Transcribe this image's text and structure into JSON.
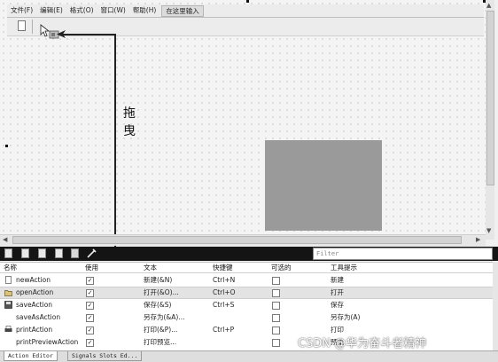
{
  "menubar": {
    "items": [
      "文件(F)",
      "编辑(E)",
      "格式(O)",
      "窗口(W)",
      "帮助(H)"
    ],
    "type_here": "在这里输入"
  },
  "annotation": {
    "drag_label": "拖\n曳"
  },
  "action_editor": {
    "filter_placeholder": "Filter",
    "columns": [
      "名称",
      "使用",
      "文本",
      "快捷键",
      "可选的",
      "工具提示"
    ],
    "rows": [
      {
        "name": "newAction",
        "used": true,
        "text": "新建(&N)",
        "shortcut": "Ctrl+N",
        "checkable": false,
        "tooltip": "新建",
        "icon": "new-file-icon",
        "selected": false
      },
      {
        "name": "openAction",
        "used": true,
        "text": "打开(&O)...",
        "shortcut": "Ctrl+O",
        "checkable": false,
        "tooltip": "打开",
        "icon": "open-folder-icon",
        "selected": true
      },
      {
        "name": "saveAction",
        "used": true,
        "text": "保存(&S)",
        "shortcut": "Ctrl+S",
        "checkable": false,
        "tooltip": "保存",
        "icon": "save-icon",
        "selected": false
      },
      {
        "name": "saveAsAction",
        "used": true,
        "text": "另存为(&A)...",
        "shortcut": "",
        "checkable": false,
        "tooltip": "另存为(A)",
        "icon": "none",
        "selected": false
      },
      {
        "name": "printAction",
        "used": true,
        "text": "打印(&P)...",
        "shortcut": "Ctrl+P",
        "checkable": false,
        "tooltip": "打印",
        "icon": "printer-icon",
        "selected": false
      },
      {
        "name": "printPreviewAction",
        "used": true,
        "text": "打印预览...",
        "shortcut": "",
        "checkable": false,
        "tooltip": "预览",
        "icon": "none",
        "selected": false
      }
    ]
  },
  "tabs": [
    "Action Editor",
    "Signals  Slots Ed..."
  ],
  "watermark": "CSDN @华为奋斗者精神",
  "colors": {
    "toolbar_dark": "#141414",
    "placeholder_widget": "#9a9a9a",
    "selected_row": "#e3e3e3"
  }
}
